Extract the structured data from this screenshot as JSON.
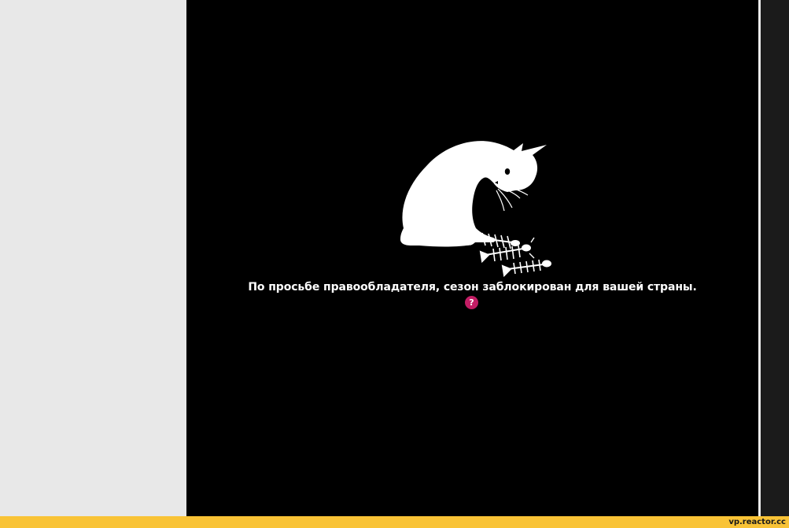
{
  "player": {
    "message": "По просьбе правообладателя, сезон заблокирован для вашей страны.",
    "help_label": "?",
    "illustration_icon": "cat-with-fish-bones-icon"
  },
  "footer": {
    "watermark": "vp.reactor.cc"
  },
  "colors": {
    "player_background": "#000000",
    "page_background": "#e8e8e8",
    "help_button": "#c21d64",
    "footer_bar": "#f9c336",
    "right_panel": "#1b1b1b"
  }
}
